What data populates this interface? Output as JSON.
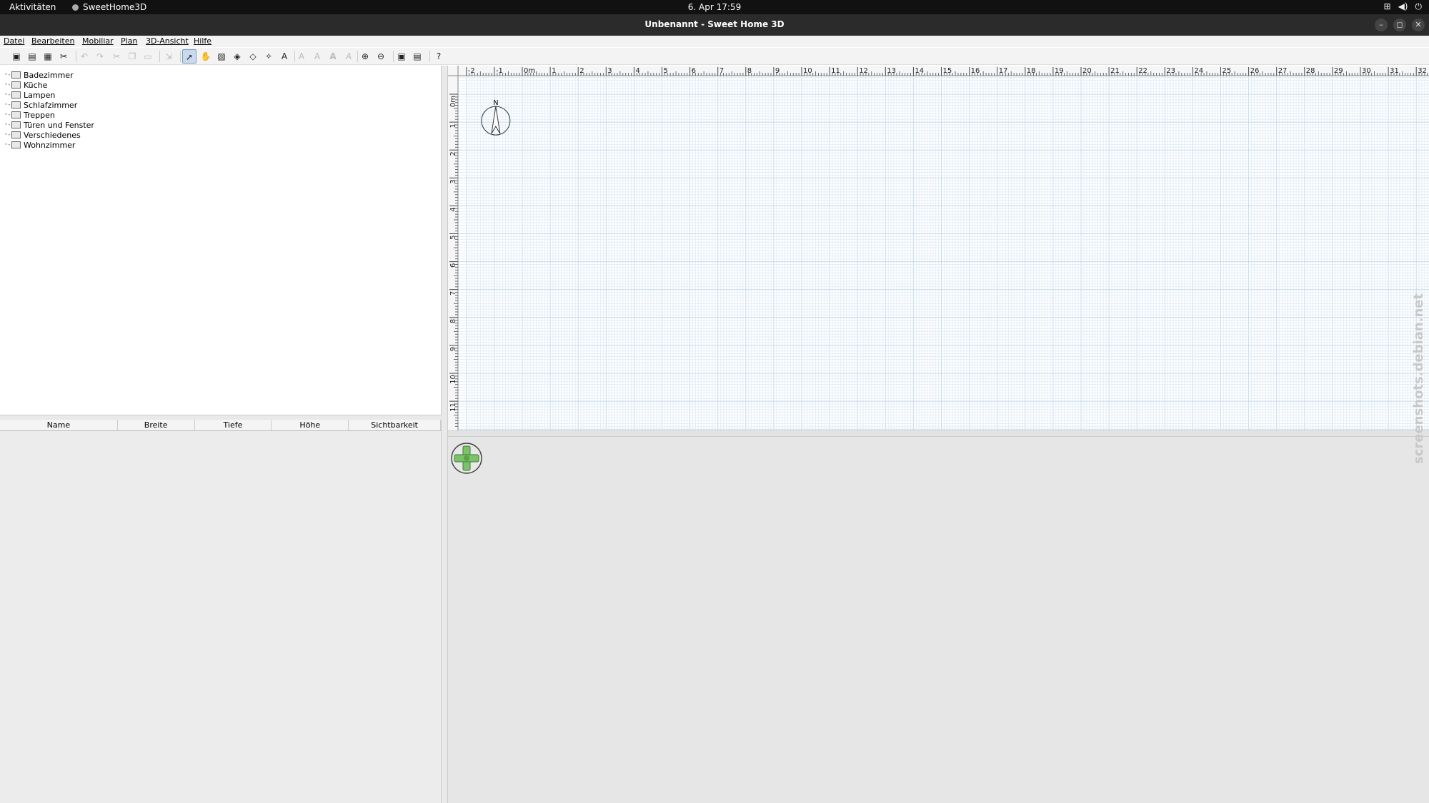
{
  "topbar": {
    "activities": "Aktivitäten",
    "app_name": "SweetHome3D",
    "clock": "6. Apr  17:59"
  },
  "window": {
    "title": "Unbenannt - Sweet Home 3D"
  },
  "menu": {
    "datei": "Datei",
    "bearbeiten": "Bearbeiten",
    "mobiliar": "Mobiliar",
    "plan": "Plan",
    "ansicht3d": "3D-Ansicht",
    "hilfe": "Hilfe"
  },
  "catalog": {
    "items": [
      "Badezimmer",
      "Küche",
      "Lampen",
      "Schlafzimmer",
      "Treppen",
      "Türen und Fenster",
      "Verschiedenes",
      "Wohnzimmer"
    ]
  },
  "furniture_table": {
    "columns": [
      "Name",
      "Breite",
      "Tiefe",
      "Höhe",
      "Sichtbarkeit"
    ]
  },
  "plan": {
    "ruler_x": [
      "-2",
      "-1",
      "0m",
      "1",
      "2",
      "3",
      "4",
      "5",
      "6",
      "7",
      "8",
      "9",
      "10",
      "11",
      "12",
      "13",
      "14",
      "15",
      "16",
      "17",
      "18",
      "19",
      "20",
      "21",
      "22",
      "23",
      "24",
      "25",
      "26",
      "27",
      "28",
      "29",
      "30",
      "31",
      "32"
    ],
    "ruler_y": [
      "0m",
      "1",
      "2",
      "3",
      "4",
      "5",
      "6",
      "7",
      "8",
      "9",
      "10",
      "11"
    ],
    "compass_label": "N"
  },
  "watermark": "screenshots.debian.net",
  "colors": {
    "grid_minor": "#e4eef6",
    "grid_major": "#c5d8ea",
    "accent": "#7a9cc8"
  }
}
